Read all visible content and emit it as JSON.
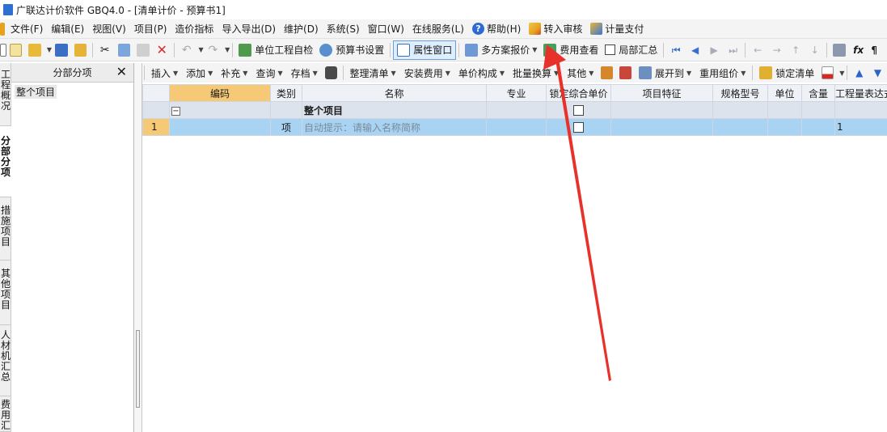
{
  "window": {
    "title": "广联达计价软件 GBQ4.0 - [清单计价 - 预算书1]"
  },
  "menu": {
    "items": [
      "文件(F)",
      "编辑(E)",
      "视图(V)",
      "项目(P)",
      "造价指标",
      "导入导出(D)",
      "维护(D)",
      "系统(S)",
      "窗口(W)",
      "在线服务(L)"
    ],
    "help": "帮助(H)",
    "audit": "转入审核",
    "pay": "计量支付"
  },
  "toolbar": {
    "self_check": "单位工程自检",
    "budget_settings": "预算书设置",
    "property_window": "属性窗口",
    "multi_quote": "多方案报价",
    "fee_view": "费用查看",
    "partial_summary": "局部汇总"
  },
  "toolbar2": {
    "items": [
      "插入",
      "添加",
      "补充",
      "查询",
      "存档"
    ],
    "items2": [
      "整理清单",
      "安装费用",
      "单价构成",
      "批量换算",
      "其他"
    ],
    "expand_to": "展开到",
    "reuse_price": "重用组价",
    "lock_list": "锁定清单"
  },
  "left_tabs": [
    "工程概况",
    "分部分项",
    "措施项目",
    "其他项目",
    "人材机汇总",
    "费用汇总"
  ],
  "left_panel": {
    "title": "分部分项",
    "tree_item": "整个项目"
  },
  "table": {
    "columns": [
      "",
      "编码",
      "类别",
      "名称",
      "专业",
      "锁定综合单价",
      "项目特征",
      "规格型号",
      "单位",
      "含量",
      "工程量表达式"
    ],
    "group_row": {
      "name": "整个项目"
    },
    "rows": [
      {
        "num": "1",
        "code": "",
        "type": "项",
        "name": "自动提示：请输入名称简称",
        "qty": "1"
      }
    ]
  },
  "colors": {
    "header_selected": "#f6c977",
    "row_selected": "#a8d3f2",
    "arrow": "#e8312a"
  }
}
